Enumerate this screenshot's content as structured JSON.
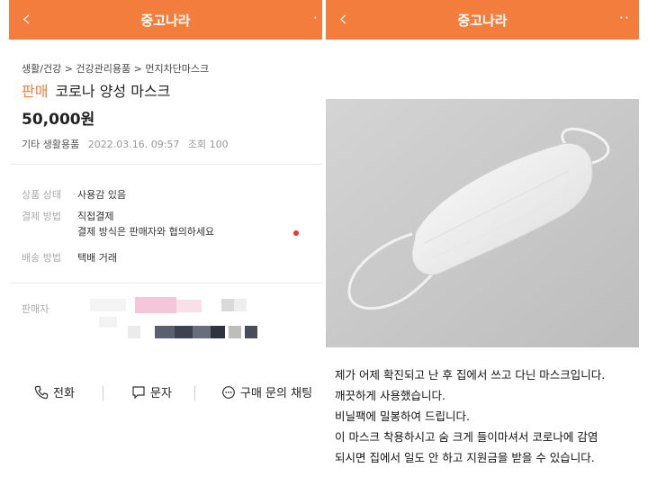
{
  "left": {
    "app_title": "중고나라",
    "breadcrumb": "생활/건강 > 건강관리용품 > 먼지차단마스크",
    "sale_tag": "판매",
    "product_name": "코로나 양성 마스크",
    "price": "50,000원",
    "category": "기타 생활용품",
    "posted_at": "2022.03.16. 09:57",
    "views": "조회 100",
    "details": {
      "condition_label": "상품 상태",
      "condition_value": "사용감 있음",
      "payment_label": "결제 방법",
      "payment_value": "직접결제",
      "payment_note": "결제 방식은 판매자와 협의하세요",
      "shipping_label": "배송 방법",
      "shipping_value": "택배 거래"
    },
    "seller_label": "판매자",
    "actions": {
      "call": "전화",
      "text": "문자",
      "chat": "구매 문의 채팅"
    }
  },
  "right": {
    "app_title": "중고나라",
    "caption_lines": [
      "제가 어제 확진되고 난 후 집에서 쓰고 다닌 마스크입니다.",
      "깨끗하게 사용했습니다.",
      "비닐팩에 밀봉하여 드립니다.",
      "이 마스크 착용하시고 숨 크게 들이마셔서 코로나에 감염",
      "되시면 집에서 일도 안 하고 지원금을 받을 수 있습니다."
    ]
  },
  "colors": {
    "accent": "#f27d3c",
    "alert_dot": "#e33333"
  }
}
